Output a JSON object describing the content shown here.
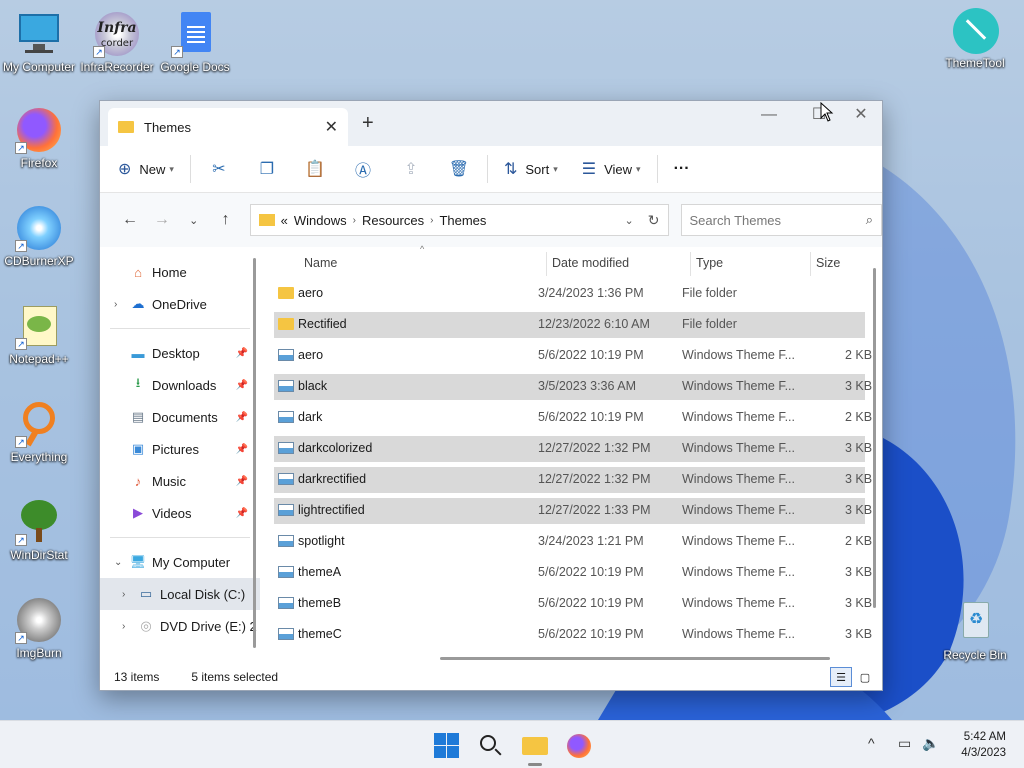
{
  "desktop": {
    "icons": [
      {
        "label": "My Computer"
      },
      {
        "label": "InfraRecorder"
      },
      {
        "label": "Google Docs"
      },
      {
        "label": "ThemeTool"
      },
      {
        "label": "Firefox"
      },
      {
        "label": "CDBurnerXP"
      },
      {
        "label": "Notepad++"
      },
      {
        "label": "Everything"
      },
      {
        "label": "WinDirStat"
      },
      {
        "label": "ImgBurn"
      },
      {
        "label": "Recycle Bin"
      }
    ],
    "logo_text": {
      "infra": "Infra",
      "corder": "corder"
    }
  },
  "window": {
    "tab_title": "Themes",
    "new_tab": "+",
    "toolbar": {
      "new_label": "New",
      "sort_label": "Sort",
      "view_label": "View",
      "more_label": "···"
    },
    "address": {
      "overflow": "«",
      "crumbs": [
        "Windows",
        "Resources",
        "Themes"
      ]
    },
    "search_placeholder": "Search Themes",
    "sidebar": {
      "home": "Home",
      "onedrive": "OneDrive",
      "desktop": "Desktop",
      "downloads": "Downloads",
      "documents": "Documents",
      "pictures": "Pictures",
      "music": "Music",
      "videos": "Videos",
      "mycomputer": "My Computer",
      "localdisk": "Local Disk (C:)",
      "dvd": "DVD Drive (E:) 2"
    },
    "columns": {
      "name": "Name",
      "date": "Date modified",
      "type": "Type",
      "size": "Size"
    },
    "files": [
      {
        "name": "aero",
        "date": "3/24/2023 1:36 PM",
        "type": "File folder",
        "size": ""
      },
      {
        "name": "Rectified",
        "date": "12/23/2022 6:10 AM",
        "type": "File folder",
        "size": ""
      },
      {
        "name": "aero",
        "date": "5/6/2022 10:19 PM",
        "type": "Windows Theme F...",
        "size": "2 KB"
      },
      {
        "name": "black",
        "date": "3/5/2023 3:36 AM",
        "type": "Windows Theme F...",
        "size": "3 KB"
      },
      {
        "name": "dark",
        "date": "5/6/2022 10:19 PM",
        "type": "Windows Theme F...",
        "size": "2 KB"
      },
      {
        "name": "darkcolorized",
        "date": "12/27/2022 1:32 PM",
        "type": "Windows Theme F...",
        "size": "3 KB"
      },
      {
        "name": "darkrectified",
        "date": "12/27/2022 1:32 PM",
        "type": "Windows Theme F...",
        "size": "3 KB"
      },
      {
        "name": "lightrectified",
        "date": "12/27/2022 1:33 PM",
        "type": "Windows Theme F...",
        "size": "3 KB"
      },
      {
        "name": "spotlight",
        "date": "3/24/2023 1:21 PM",
        "type": "Windows Theme F...",
        "size": "2 KB"
      },
      {
        "name": "themeA",
        "date": "5/6/2022 10:19 PM",
        "type": "Windows Theme F...",
        "size": "3 KB"
      },
      {
        "name": "themeB",
        "date": "5/6/2022 10:19 PM",
        "type": "Windows Theme F...",
        "size": "3 KB"
      },
      {
        "name": "themeC",
        "date": "5/6/2022 10:19 PM",
        "type": "Windows Theme F...",
        "size": "3 KB"
      }
    ],
    "status": {
      "items": "13 items",
      "selected": "5 items selected"
    }
  },
  "taskbar": {
    "time": "5:42 AM",
    "date": "4/3/2023"
  },
  "colors": {
    "folder": "#f5c542",
    "accent": "#2b6cb0",
    "selection": "#d9d9d9"
  }
}
